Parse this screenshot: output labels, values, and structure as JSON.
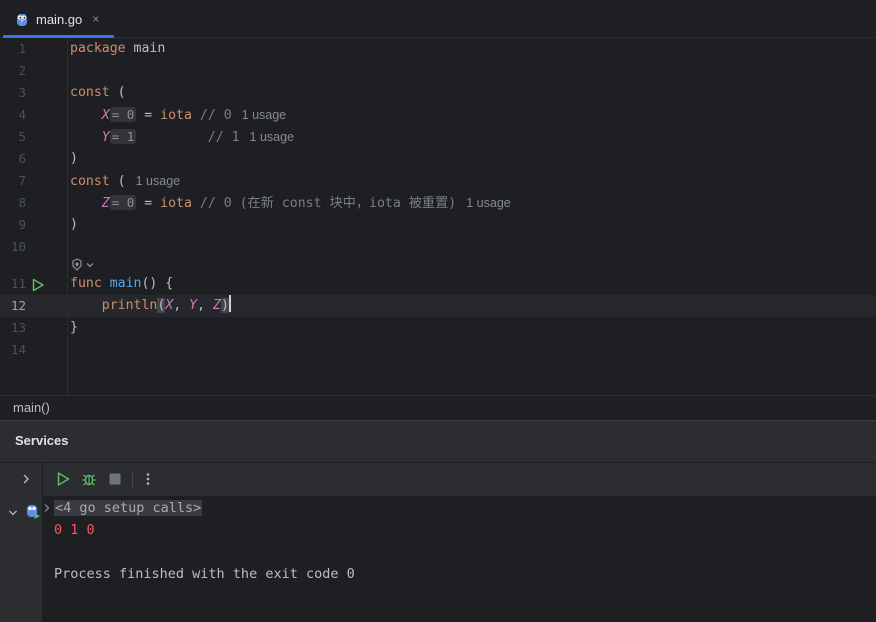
{
  "tab": {
    "icon": "gopher-icon",
    "label": "main.go",
    "close_glyph": "×"
  },
  "editor": {
    "current_line": 12,
    "line_numbers": [
      "1",
      "2",
      "3",
      "4",
      "5",
      "6",
      "7",
      "8",
      "9",
      "10",
      "11",
      "12",
      "13",
      "14"
    ],
    "line1": {
      "kw": "package",
      "name": "main"
    },
    "line3": {
      "kw": "const",
      "paren": "("
    },
    "line4": {
      "const": "X",
      "hint_eq": "=",
      "hint_val": "0",
      "eq": "=",
      "iota": "iota",
      "comment": "// 0",
      "usage": "1 usage"
    },
    "line5": {
      "const": "Y",
      "hint_eq": "=",
      "hint_val": "1",
      "comment": "// 1",
      "usage": "1 usage"
    },
    "line6": {
      "paren": ")"
    },
    "line7": {
      "kw": "const",
      "paren": "(",
      "usage": "1 usage"
    },
    "line8": {
      "const": "Z",
      "hint_eq": "=",
      "hint_val": "0",
      "eq": "=",
      "iota": "iota",
      "comment": "// 0 (在新 const 块中，iota 被重置)",
      "usage": "1 usage"
    },
    "line9": {
      "paren": ")"
    },
    "line11": {
      "kw": "func",
      "fn": "main",
      "sig": "() {"
    },
    "line12": {
      "fn": "println",
      "open": "(",
      "a": "X",
      "comma1": ", ",
      "b": "Y",
      "comma2": ", ",
      "c": "Z",
      "close": ")"
    },
    "line13": {
      "brace": "}"
    }
  },
  "breadcrumb": {
    "label": "main()"
  },
  "services": {
    "title": "Services",
    "folded_text": "<4 go setup calls>",
    "output_values": "0 1 0",
    "finished_text": "Process finished with the exit code 0"
  },
  "colors": {
    "accent": "#3574f0",
    "run_green": "#5fb865",
    "output_red": "#f75464"
  }
}
